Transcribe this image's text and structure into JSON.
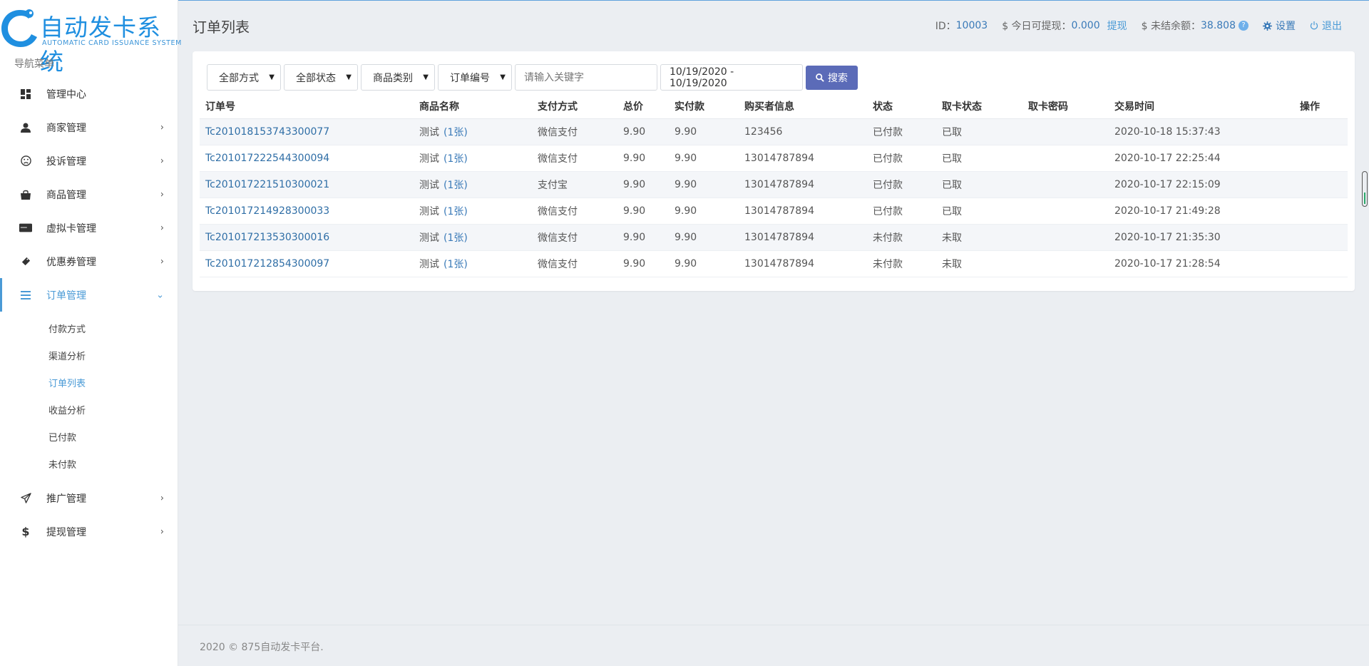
{
  "brand": {
    "title": "自动发卡系统",
    "subtitle": "AUTOMATIC CARD ISSUANCE SYSTEM"
  },
  "sidebar": {
    "heading": "导航菜单",
    "items": [
      {
        "label": "管理中心",
        "icon": "dashboard-icon"
      },
      {
        "label": "商家管理",
        "icon": "user-icon"
      },
      {
        "label": "投诉管理",
        "icon": "frown-icon"
      },
      {
        "label": "商品管理",
        "icon": "shopping-bag-icon"
      },
      {
        "label": "虚拟卡管理",
        "icon": "card-icon"
      },
      {
        "label": "优惠券管理",
        "icon": "ticket-icon"
      },
      {
        "label": "订单管理",
        "icon": "list-icon"
      },
      {
        "label": "推广管理",
        "icon": "send-icon"
      },
      {
        "label": "提现管理",
        "icon": "dollar-icon"
      }
    ],
    "order_subitems": [
      "付款方式",
      "渠道分析",
      "订单列表",
      "收益分析",
      "已付款",
      "未付款"
    ]
  },
  "header": {
    "page_title": "订单列表",
    "id_label": "ID：",
    "id_value": "10003",
    "withdraw_label": "$ 今日可提现：",
    "withdraw_value": "0.000",
    "withdraw_link": "提现",
    "balance_label": "$ 未结余额：",
    "balance_value": "38.808",
    "help": "?",
    "settings": "设置",
    "logout": "退出"
  },
  "filters": {
    "method": "全部方式",
    "status": "全部状态",
    "category": "商品类别",
    "field": "订单编号",
    "keyword_placeholder": "请输入关键字",
    "date_range": "10/19/2020 - 10/19/2020",
    "search_button": "搜索"
  },
  "table": {
    "columns": [
      "订单号",
      "商品名称",
      "支付方式",
      "总价",
      "实付款",
      "购买者信息",
      "状态",
      "取卡状态",
      "取卡密码",
      "交易时间",
      "操作"
    ],
    "rows": [
      {
        "order": "Tc201018153743300077",
        "product": "测试",
        "count": "(1张)",
        "pay": "微信支付",
        "total": "9.90",
        "paid": "9.90",
        "buyer": "123456",
        "status": "已付款",
        "card_status": "已取",
        "card_pwd": "",
        "time": "2020-10-18 15:37:43"
      },
      {
        "order": "Tc201017222544300094",
        "product": "测试",
        "count": "(1张)",
        "pay": "微信支付",
        "total": "9.90",
        "paid": "9.90",
        "buyer": "13014787894",
        "status": "已付款",
        "card_status": "已取",
        "card_pwd": "",
        "time": "2020-10-17 22:25:44"
      },
      {
        "order": "Tc201017221510300021",
        "product": "测试",
        "count": "(1张)",
        "pay": "支付宝",
        "total": "9.90",
        "paid": "9.90",
        "buyer": "13014787894",
        "status": "已付款",
        "card_status": "已取",
        "card_pwd": "",
        "time": "2020-10-17 22:15:09"
      },
      {
        "order": "Tc201017214928300033",
        "product": "测试",
        "count": "(1张)",
        "pay": "微信支付",
        "total": "9.90",
        "paid": "9.90",
        "buyer": "13014787894",
        "status": "已付款",
        "card_status": "已取",
        "card_pwd": "",
        "time": "2020-10-17 21:49:28"
      },
      {
        "order": "Tc201017213530300016",
        "product": "测试",
        "count": "(1张)",
        "pay": "微信支付",
        "total": "9.90",
        "paid": "9.90",
        "buyer": "13014787894",
        "status": "未付款",
        "card_status": "未取",
        "card_pwd": "",
        "time": "2020-10-17 21:35:30"
      },
      {
        "order": "Tc201017212854300097",
        "product": "测试",
        "count": "(1张)",
        "pay": "微信支付",
        "total": "9.90",
        "paid": "9.90",
        "buyer": "13014787894",
        "status": "未付款",
        "card_status": "未取",
        "card_pwd": "",
        "time": "2020-10-17 21:28:54"
      }
    ]
  },
  "footer": {
    "text": "2020 © 875自动发卡平台."
  },
  "colors": {
    "accent": "#4a9ad6",
    "button": "#5b6bb8",
    "link": "#2f6ea6"
  }
}
